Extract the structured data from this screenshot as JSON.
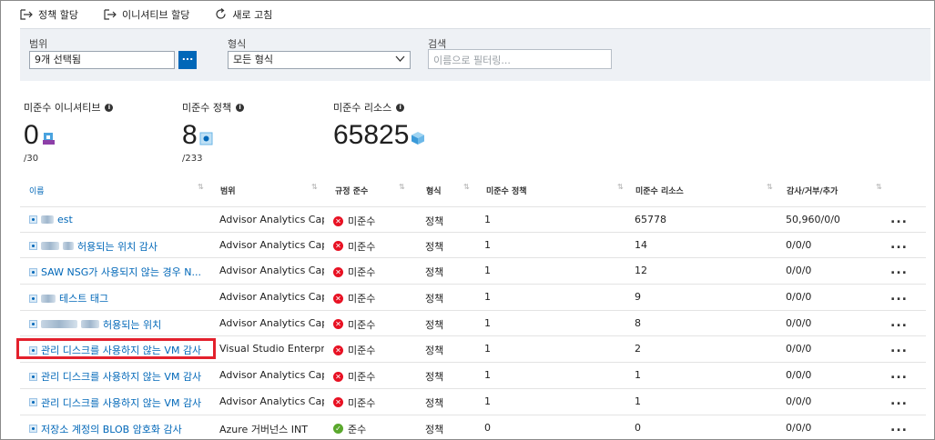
{
  "toolbar": {
    "assign_policy": "정책 할당",
    "assign_initiative": "이니셔티브 할당",
    "refresh": "새로 고침"
  },
  "filters": {
    "scope_label": "범위",
    "scope_value": "9개 선택됨",
    "scope_button": "...",
    "type_label": "형식",
    "type_value": "모든 형식",
    "search_label": "검색",
    "search_placeholder": "이름으로 필터링..."
  },
  "stats": {
    "initiatives": {
      "label": "미준수 이니셔티브",
      "value": "0",
      "total": "/30"
    },
    "policies": {
      "label": "미준수 정책",
      "value": "8",
      "total": "/233"
    },
    "resources": {
      "label": "미준수 리소스",
      "value": "65825"
    }
  },
  "table": {
    "columns": [
      "이름",
      "범위",
      "규정 준수",
      "형식",
      "미준수 정책",
      "미준수 리소스",
      "감사/거부/추가"
    ],
    "rows": [
      {
        "name": "est",
        "scope": "Advisor Analytics Capa...",
        "status": "미준수",
        "compliant": false,
        "type": "정책",
        "noncompliant_policies": "1",
        "noncompliant_resources": "65778",
        "audit": "50,960/0/0"
      },
      {
        "name": "허용되는 위치 감사",
        "scope": "Advisor Analytics Capa...",
        "status": "미준수",
        "compliant": false,
        "type": "정책",
        "noncompliant_policies": "1",
        "noncompliant_resources": "14",
        "audit": "0/0/0"
      },
      {
        "name": "SAW NSG가 사용되지 않는 경우 N...",
        "scope": "Advisor Analytics Capa...",
        "status": "미준수",
        "compliant": false,
        "type": "정책",
        "noncompliant_policies": "1",
        "noncompliant_resources": "12",
        "audit": "0/0/0"
      },
      {
        "name": "테스트 태그",
        "scope": "Advisor Analytics Capa...",
        "status": "미준수",
        "compliant": false,
        "type": "정책",
        "noncompliant_policies": "1",
        "noncompliant_resources": "9",
        "audit": "0/0/0"
      },
      {
        "name": "허용되는 위치",
        "scope": "Advisor Analytics Capa...",
        "status": "미준수",
        "compliant": false,
        "type": "정책",
        "noncompliant_policies": "1",
        "noncompliant_resources": "8",
        "audit": "0/0/0"
      },
      {
        "name": "관리 디스크를 사용하지 않는 VM 감사",
        "scope": "Visual Studio Enterprise",
        "status": "미준수",
        "compliant": false,
        "type": "정책",
        "noncompliant_policies": "1",
        "noncompliant_resources": "2",
        "audit": "0/0/0",
        "highlighted": true
      },
      {
        "name": "관리 디스크를 사용하지 않는 VM 감사",
        "scope": "Advisor Analytics Capa...",
        "status": "미준수",
        "compliant": false,
        "type": "정책",
        "noncompliant_policies": "1",
        "noncompliant_resources": "1",
        "audit": "0/0/0"
      },
      {
        "name": "관리 디스크를 사용하지 않는 VM 감사",
        "scope": "Advisor Analytics Capa...",
        "status": "미준수",
        "compliant": false,
        "type": "정책",
        "noncompliant_policies": "1",
        "noncompliant_resources": "1",
        "audit": "0/0/0"
      },
      {
        "name": "저장소 계정의 BLOB 암호화 감사",
        "scope": "Azure 거버넌스 INT",
        "status": "준수",
        "compliant": true,
        "type": "정책",
        "noncompliant_policies": "0",
        "noncompliant_resources": "0",
        "audit": "0/0/0"
      }
    ],
    "more_label": "..."
  },
  "colors": {
    "accent": "#0067b8",
    "error": "#e81123",
    "success": "#5aa82d",
    "highlight": "#e3202c"
  }
}
